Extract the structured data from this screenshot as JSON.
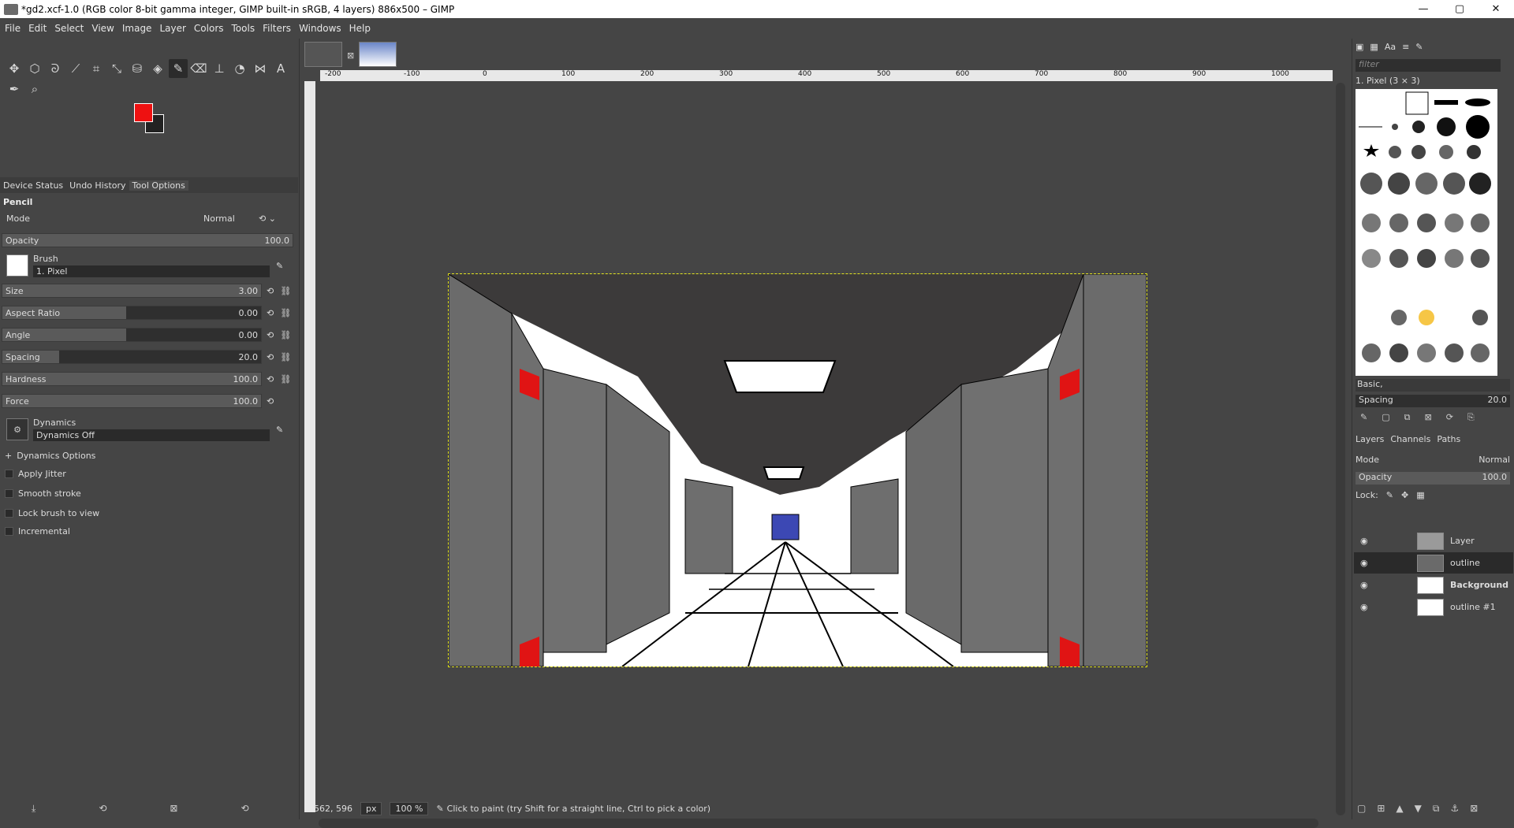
{
  "window": {
    "title": "*gd2.xcf-1.0 (RGB color 8-bit gamma integer, GIMP built-in sRGB, 4 layers) 886x500 – GIMP",
    "controls": [
      "—",
      "▢",
      "✕"
    ]
  },
  "menu": [
    "File",
    "Edit",
    "Select",
    "View",
    "Image",
    "Layer",
    "Colors",
    "Tools",
    "Filters",
    "Windows",
    "Help"
  ],
  "left_tabs": [
    "Device Status",
    "Undo History",
    "Tool Options"
  ],
  "tool_options": {
    "tool_name": "Pencil",
    "mode_label": "Mode",
    "mode_value": "Normal",
    "opacity": {
      "label": "Opacity",
      "value": "100.0",
      "fraction": 1.0
    },
    "brush_label": "Brush",
    "brush_value": "1. Pixel",
    "size": {
      "label": "Size",
      "value": "3.00",
      "fraction": 1.0
    },
    "aspect": {
      "label": "Aspect Ratio",
      "value": "0.00",
      "fraction": 0.5
    },
    "angle": {
      "label": "Angle",
      "value": "0.00",
      "fraction": 0.5
    },
    "spacing": {
      "label": "Spacing",
      "value": "20.0",
      "fraction": 0.2
    },
    "hardness": {
      "label": "Hardness",
      "value": "100.0",
      "fraction": 1.0
    },
    "force": {
      "label": "Force",
      "value": "100.0",
      "fraction": 1.0
    },
    "dynamics_label": "Dynamics",
    "dynamics_value": "Dynamics Off",
    "dynamics_options": "Dynamics Options",
    "apply_jitter": "Apply Jitter",
    "smooth_stroke": "Smooth stroke",
    "lock_brush": "Lock brush to view",
    "incremental": "Incremental"
  },
  "colors": {
    "foreground": "#ee1111",
    "background": "#222222"
  },
  "ruler_labels": [
    "-200",
    "-100",
    "0",
    "100",
    "200",
    "300",
    "400",
    "500",
    "600",
    "700",
    "800",
    "900",
    "1000"
  ],
  "status": {
    "coords": "562, 596",
    "unit": "px",
    "zoom": "100 %",
    "message": "Click to paint (try Shift for a straight line, Ctrl to pick a color)"
  },
  "brushes": {
    "filter_placeholder": "filter",
    "current": "1. Pixel (3 × 3)",
    "set": "Basic,",
    "spacing_label": "Spacing",
    "spacing_value": "20.0"
  },
  "right_tabs": [
    "Layers",
    "Channels",
    "Paths"
  ],
  "layers_panel": {
    "mode_label": "Mode",
    "mode_value": "Normal",
    "opacity_label": "Opacity",
    "opacity_value": "100.0",
    "lock_label": "Lock:",
    "layers": [
      {
        "name": "Layer",
        "selected": false
      },
      {
        "name": "outline",
        "selected": true
      },
      {
        "name": "Background",
        "selected": false
      },
      {
        "name": "outline #1",
        "selected": false
      }
    ]
  }
}
